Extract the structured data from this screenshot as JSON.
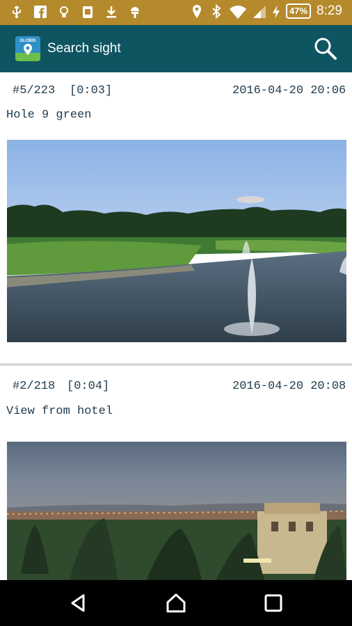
{
  "status_bar": {
    "battery": "47%",
    "time": "8:29",
    "icons": [
      "usb-icon",
      "facebook-icon",
      "lightbulb-icon",
      "clipboard-icon",
      "download-icon",
      "android-icon",
      "location-icon",
      "bluetooth-icon",
      "wifi-icon",
      "signal-icon",
      "charging-icon"
    ]
  },
  "app_bar": {
    "title": "Search sight",
    "search_icon": "search-icon"
  },
  "posts": [
    {
      "id": "#5/223",
      "duration": "[0:03]",
      "timestamp": "2016-04-20 20:06",
      "caption": "Hole 9 green"
    },
    {
      "id": "#2/218",
      "duration": "[0:04]",
      "timestamp": "2016-04-20 20:08",
      "caption": "View from hotel"
    }
  ],
  "nav_bar": {
    "buttons": [
      "back-icon",
      "home-icon",
      "recents-icon"
    ]
  },
  "colors": {
    "status_bar": "#b58a2c",
    "app_bar": "#0f5561",
    "text": "#1f3b4d"
  }
}
